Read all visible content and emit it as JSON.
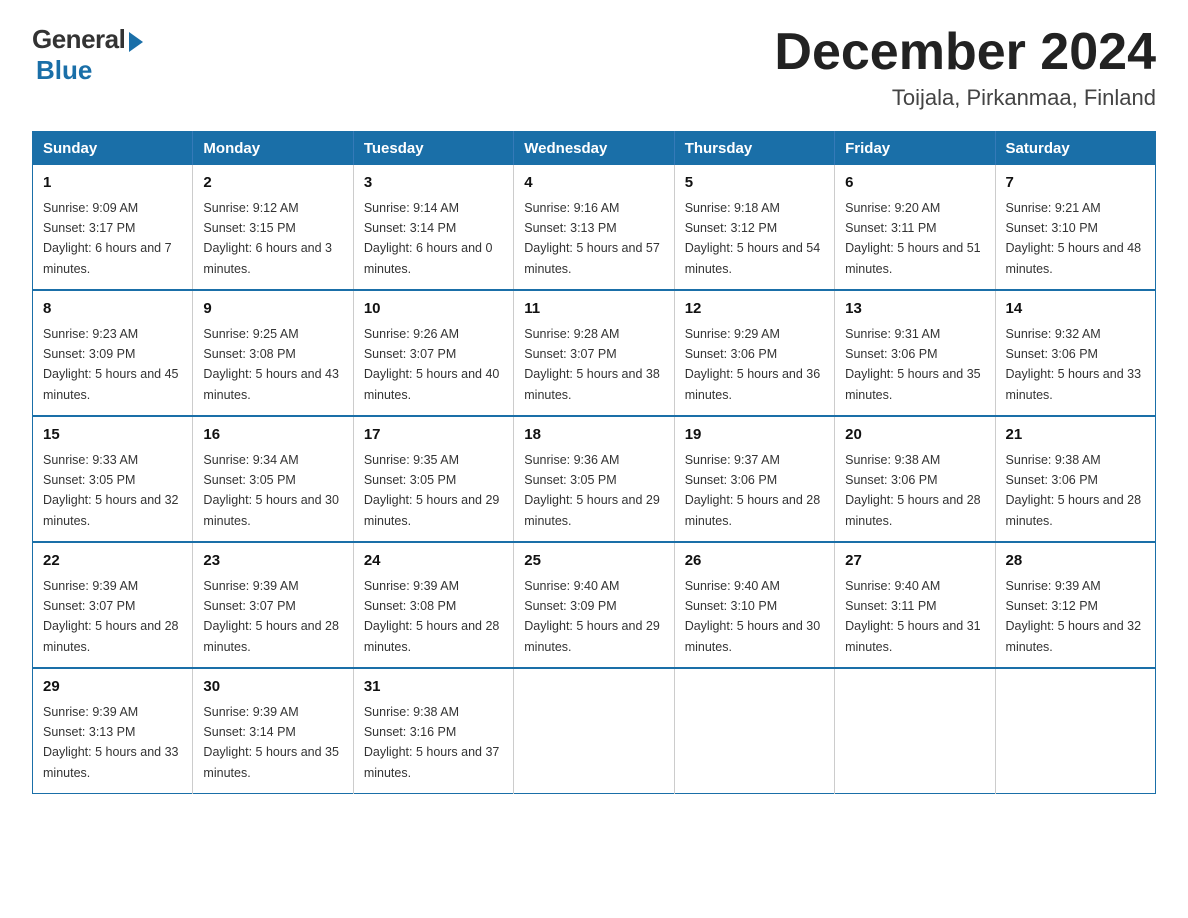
{
  "logo": {
    "general": "General",
    "blue": "Blue"
  },
  "title": "December 2024",
  "location": "Toijala, Pirkanmaa, Finland",
  "days_of_week": [
    "Sunday",
    "Monday",
    "Tuesday",
    "Wednesday",
    "Thursday",
    "Friday",
    "Saturday"
  ],
  "weeks": [
    [
      {
        "day": "1",
        "sunrise": "Sunrise: 9:09 AM",
        "sunset": "Sunset: 3:17 PM",
        "daylight": "Daylight: 6 hours and 7 minutes."
      },
      {
        "day": "2",
        "sunrise": "Sunrise: 9:12 AM",
        "sunset": "Sunset: 3:15 PM",
        "daylight": "Daylight: 6 hours and 3 minutes."
      },
      {
        "day": "3",
        "sunrise": "Sunrise: 9:14 AM",
        "sunset": "Sunset: 3:14 PM",
        "daylight": "Daylight: 6 hours and 0 minutes."
      },
      {
        "day": "4",
        "sunrise": "Sunrise: 9:16 AM",
        "sunset": "Sunset: 3:13 PM",
        "daylight": "Daylight: 5 hours and 57 minutes."
      },
      {
        "day": "5",
        "sunrise": "Sunrise: 9:18 AM",
        "sunset": "Sunset: 3:12 PM",
        "daylight": "Daylight: 5 hours and 54 minutes."
      },
      {
        "day": "6",
        "sunrise": "Sunrise: 9:20 AM",
        "sunset": "Sunset: 3:11 PM",
        "daylight": "Daylight: 5 hours and 51 minutes."
      },
      {
        "day": "7",
        "sunrise": "Sunrise: 9:21 AM",
        "sunset": "Sunset: 3:10 PM",
        "daylight": "Daylight: 5 hours and 48 minutes."
      }
    ],
    [
      {
        "day": "8",
        "sunrise": "Sunrise: 9:23 AM",
        "sunset": "Sunset: 3:09 PM",
        "daylight": "Daylight: 5 hours and 45 minutes."
      },
      {
        "day": "9",
        "sunrise": "Sunrise: 9:25 AM",
        "sunset": "Sunset: 3:08 PM",
        "daylight": "Daylight: 5 hours and 43 minutes."
      },
      {
        "day": "10",
        "sunrise": "Sunrise: 9:26 AM",
        "sunset": "Sunset: 3:07 PM",
        "daylight": "Daylight: 5 hours and 40 minutes."
      },
      {
        "day": "11",
        "sunrise": "Sunrise: 9:28 AM",
        "sunset": "Sunset: 3:07 PM",
        "daylight": "Daylight: 5 hours and 38 minutes."
      },
      {
        "day": "12",
        "sunrise": "Sunrise: 9:29 AM",
        "sunset": "Sunset: 3:06 PM",
        "daylight": "Daylight: 5 hours and 36 minutes."
      },
      {
        "day": "13",
        "sunrise": "Sunrise: 9:31 AM",
        "sunset": "Sunset: 3:06 PM",
        "daylight": "Daylight: 5 hours and 35 minutes."
      },
      {
        "day": "14",
        "sunrise": "Sunrise: 9:32 AM",
        "sunset": "Sunset: 3:06 PM",
        "daylight": "Daylight: 5 hours and 33 minutes."
      }
    ],
    [
      {
        "day": "15",
        "sunrise": "Sunrise: 9:33 AM",
        "sunset": "Sunset: 3:05 PM",
        "daylight": "Daylight: 5 hours and 32 minutes."
      },
      {
        "day": "16",
        "sunrise": "Sunrise: 9:34 AM",
        "sunset": "Sunset: 3:05 PM",
        "daylight": "Daylight: 5 hours and 30 minutes."
      },
      {
        "day": "17",
        "sunrise": "Sunrise: 9:35 AM",
        "sunset": "Sunset: 3:05 PM",
        "daylight": "Daylight: 5 hours and 29 minutes."
      },
      {
        "day": "18",
        "sunrise": "Sunrise: 9:36 AM",
        "sunset": "Sunset: 3:05 PM",
        "daylight": "Daylight: 5 hours and 29 minutes."
      },
      {
        "day": "19",
        "sunrise": "Sunrise: 9:37 AM",
        "sunset": "Sunset: 3:06 PM",
        "daylight": "Daylight: 5 hours and 28 minutes."
      },
      {
        "day": "20",
        "sunrise": "Sunrise: 9:38 AM",
        "sunset": "Sunset: 3:06 PM",
        "daylight": "Daylight: 5 hours and 28 minutes."
      },
      {
        "day": "21",
        "sunrise": "Sunrise: 9:38 AM",
        "sunset": "Sunset: 3:06 PM",
        "daylight": "Daylight: 5 hours and 28 minutes."
      }
    ],
    [
      {
        "day": "22",
        "sunrise": "Sunrise: 9:39 AM",
        "sunset": "Sunset: 3:07 PM",
        "daylight": "Daylight: 5 hours and 28 minutes."
      },
      {
        "day": "23",
        "sunrise": "Sunrise: 9:39 AM",
        "sunset": "Sunset: 3:07 PM",
        "daylight": "Daylight: 5 hours and 28 minutes."
      },
      {
        "day": "24",
        "sunrise": "Sunrise: 9:39 AM",
        "sunset": "Sunset: 3:08 PM",
        "daylight": "Daylight: 5 hours and 28 minutes."
      },
      {
        "day": "25",
        "sunrise": "Sunrise: 9:40 AM",
        "sunset": "Sunset: 3:09 PM",
        "daylight": "Daylight: 5 hours and 29 minutes."
      },
      {
        "day": "26",
        "sunrise": "Sunrise: 9:40 AM",
        "sunset": "Sunset: 3:10 PM",
        "daylight": "Daylight: 5 hours and 30 minutes."
      },
      {
        "day": "27",
        "sunrise": "Sunrise: 9:40 AM",
        "sunset": "Sunset: 3:11 PM",
        "daylight": "Daylight: 5 hours and 31 minutes."
      },
      {
        "day": "28",
        "sunrise": "Sunrise: 9:39 AM",
        "sunset": "Sunset: 3:12 PM",
        "daylight": "Daylight: 5 hours and 32 minutes."
      }
    ],
    [
      {
        "day": "29",
        "sunrise": "Sunrise: 9:39 AM",
        "sunset": "Sunset: 3:13 PM",
        "daylight": "Daylight: 5 hours and 33 minutes."
      },
      {
        "day": "30",
        "sunrise": "Sunrise: 9:39 AM",
        "sunset": "Sunset: 3:14 PM",
        "daylight": "Daylight: 5 hours and 35 minutes."
      },
      {
        "day": "31",
        "sunrise": "Sunrise: 9:38 AM",
        "sunset": "Sunset: 3:16 PM",
        "daylight": "Daylight: 5 hours and 37 minutes."
      },
      {
        "day": "",
        "sunrise": "",
        "sunset": "",
        "daylight": ""
      },
      {
        "day": "",
        "sunrise": "",
        "sunset": "",
        "daylight": ""
      },
      {
        "day": "",
        "sunrise": "",
        "sunset": "",
        "daylight": ""
      },
      {
        "day": "",
        "sunrise": "",
        "sunset": "",
        "daylight": ""
      }
    ]
  ]
}
